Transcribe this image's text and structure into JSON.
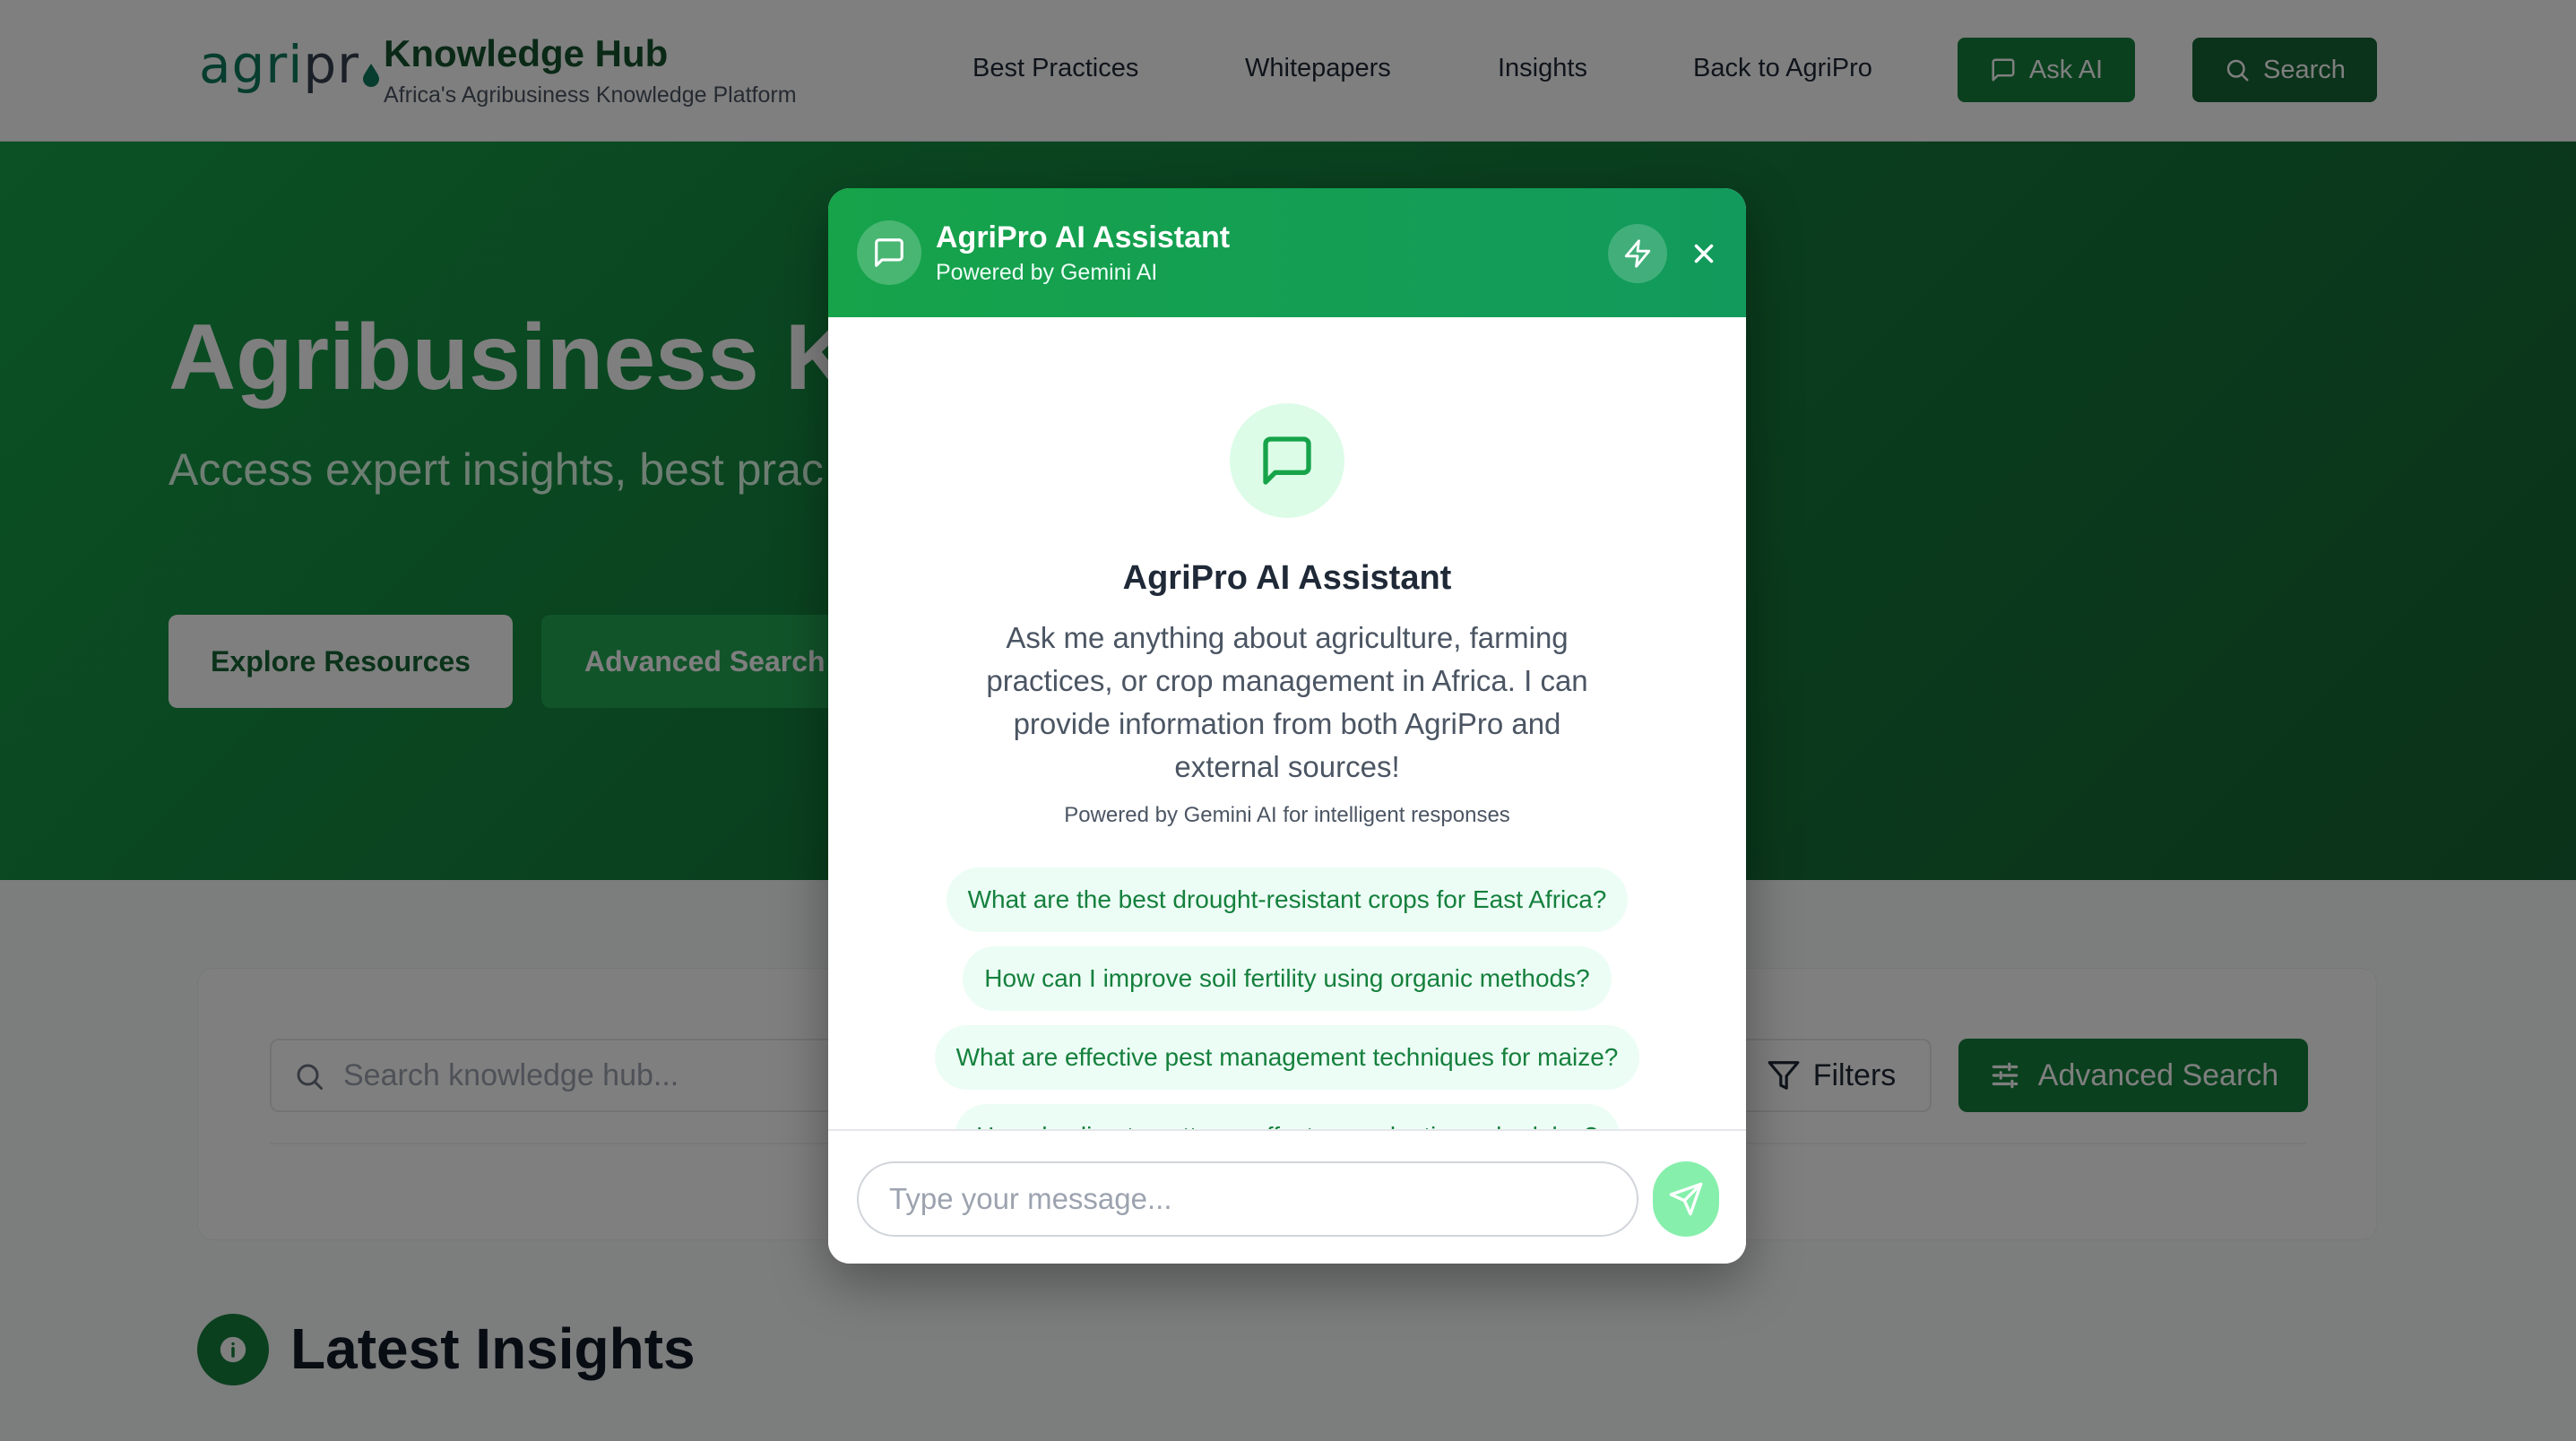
{
  "header": {
    "logo_text_a": "agri",
    "logo_text_b": "pr",
    "title": "Knowledge Hub",
    "subtitle": "Africa's Agribusiness Knowledge Platform",
    "nav": [
      "Best Practices",
      "Whitepapers",
      "Insights",
      "Back to AgriPro"
    ],
    "ask_ai_label": "Ask AI",
    "search_label": "Search"
  },
  "hero": {
    "title": "Agribusiness Kr",
    "subtitle": "Access expert insights, best prac agribusiness",
    "explore_label": "Explore Resources",
    "advanced_label": "Advanced Search"
  },
  "search": {
    "placeholder": "Search knowledge hub...",
    "filters_label": "Filters",
    "advanced_label": "Advanced Search"
  },
  "latest": {
    "title": "Latest Insights"
  },
  "modal": {
    "title": "AgriPro AI Assistant",
    "subtitle": "Powered by Gemini AI",
    "welcome_title": "AgriPro AI Assistant",
    "welcome_desc": "Ask me anything about agriculture, farming practices, or crop management in Africa. I can provide information from both AgriPro and external sources!",
    "powered_note": "Powered by Gemini AI for intelligent responses",
    "suggestions": [
      "What are the best drought-resistant crops for East Africa?",
      "How can I improve soil fertility using organic methods?",
      "What are effective pest management techniques for maize?",
      "How do climate patterns affect crop planting schedules?"
    ],
    "input_placeholder": "Type your message..."
  },
  "colors": {
    "brand_green": "#15803d",
    "accent_light": "#dcfce7",
    "overlay": "rgba(0,0,0,0.5)"
  }
}
